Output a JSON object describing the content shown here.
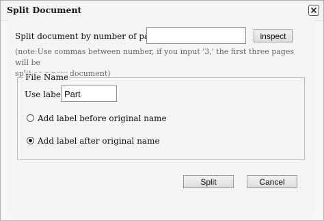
{
  "window": {
    "title": "Split Document",
    "close_icon": "close-icon"
  },
  "split": {
    "label": "Split document by number of pages:",
    "pages_value": "",
    "inspect_label": "inspect",
    "note_line1": "(note:Use commas between number, if you input '3,' the first three pages will be",
    "note_line2": "split as a new document)"
  },
  "file_name": {
    "legend": "File Name",
    "use_label_label": "Use label:",
    "use_label_value": "Part",
    "options": [
      {
        "label": "Add label before original name",
        "selected": false
      },
      {
        "label": "Add label after original name",
        "selected": true
      }
    ]
  },
  "buttons": {
    "split_label": "Split",
    "cancel_label": "Cancel"
  }
}
